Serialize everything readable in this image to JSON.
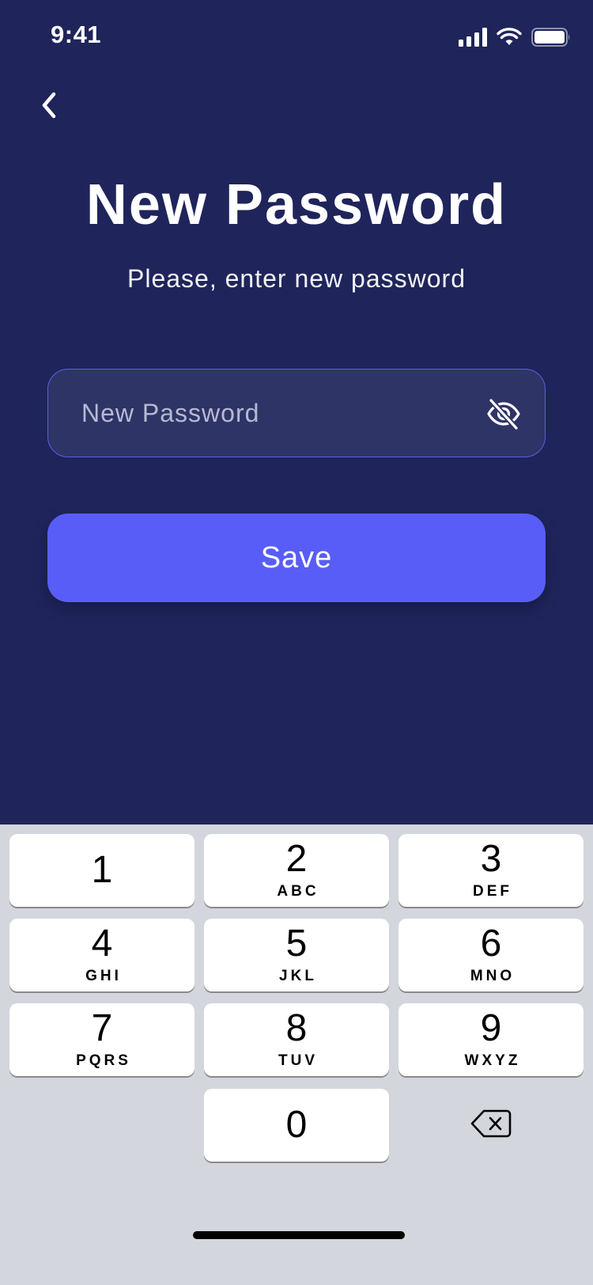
{
  "status_bar": {
    "time": "9:41",
    "icons": [
      "cellular-signal-icon",
      "wifi-icon",
      "battery-icon"
    ]
  },
  "header": {
    "back_icon": "chevron-left-icon",
    "title": "New Password",
    "subtitle": "Please, enter new password"
  },
  "form": {
    "password_value": "",
    "password_placeholder": "New Password",
    "visibility_icon": "eye-off-icon",
    "save_label": "Save"
  },
  "keypad": {
    "keys": [
      {
        "digit": "1",
        "letters": ""
      },
      {
        "digit": "2",
        "letters": "ABC"
      },
      {
        "digit": "3",
        "letters": "DEF"
      },
      {
        "digit": "4",
        "letters": "GHI"
      },
      {
        "digit": "5",
        "letters": "JKL"
      },
      {
        "digit": "6",
        "letters": "MNO"
      },
      {
        "digit": "7",
        "letters": "PQRS"
      },
      {
        "digit": "8",
        "letters": "TUV"
      },
      {
        "digit": "9",
        "letters": "WXYZ"
      },
      {
        "digit": "0",
        "letters": ""
      }
    ],
    "delete_icon": "backspace-icon"
  },
  "colors": {
    "background": "#1f245b",
    "accent": "#585df7",
    "input_background": "#2f3466",
    "input_border": "#5a5ee8",
    "keyboard_background": "#d3d6dc"
  }
}
